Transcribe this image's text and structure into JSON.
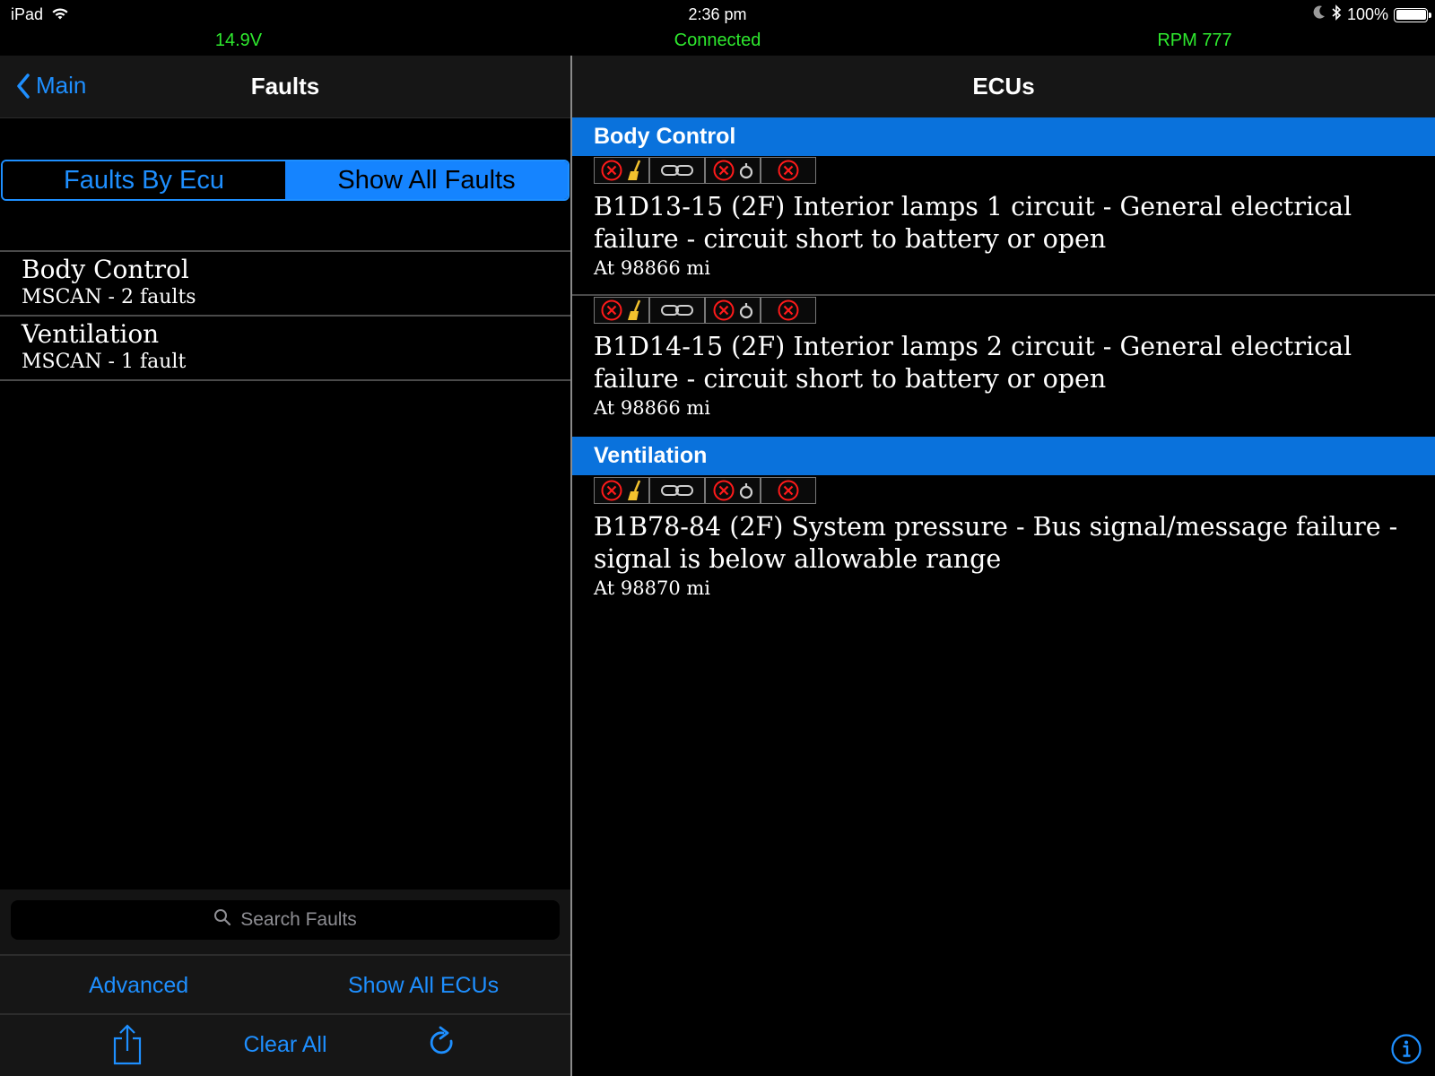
{
  "status_bar": {
    "device": "iPad",
    "time": "2:36 pm",
    "battery": "100%",
    "icons": [
      "wifi-icon",
      "moon-icon",
      "bluetooth-icon",
      "battery-icon"
    ]
  },
  "telemetry": {
    "voltage": "14.9V",
    "connection": "Connected",
    "rpm": "RPM 777",
    "color": "#2ee82e"
  },
  "left_nav": {
    "back_label": "Main",
    "title": "Faults"
  },
  "segment": {
    "options": [
      "Faults By Ecu",
      "Show All Faults"
    ],
    "selected": "Show All Faults"
  },
  "ecu_list": [
    {
      "name": "Body Control",
      "subtitle": "MSCAN - 2 faults"
    },
    {
      "name": "Ventilation",
      "subtitle": "MSCAN - 1 fault"
    }
  ],
  "search": {
    "placeholder": "Search Faults"
  },
  "bottom": {
    "advanced": "Advanced",
    "show_all_ecus": "Show All ECUs",
    "clear_all": "Clear All"
  },
  "right_nav": {
    "title": "ECUs"
  },
  "sections": [
    {
      "header": "Body Control",
      "faults": [
        {
          "description": "B1D13-15 (2F) Interior lamps 1 circuit - General electrical failure - circuit short to battery or open",
          "mileage": "At 98866 mi"
        },
        {
          "description": "B1D14-15 (2F) Interior lamps 2 circuit - General electrical failure - circuit short to battery or open",
          "mileage": "At 98866 mi"
        }
      ]
    },
    {
      "header": "Ventilation",
      "faults": [
        {
          "description": "B1B78-84 (2F) System pressure - Bus signal/message failure - signal is below allowable range",
          "mileage": "At 98870 mi"
        }
      ]
    }
  ],
  "colors": {
    "accent": "#1e8fff",
    "section_header": "#0a72dc",
    "fault_icon_red": "#ff1a1a",
    "broom": "#f2c12e"
  }
}
